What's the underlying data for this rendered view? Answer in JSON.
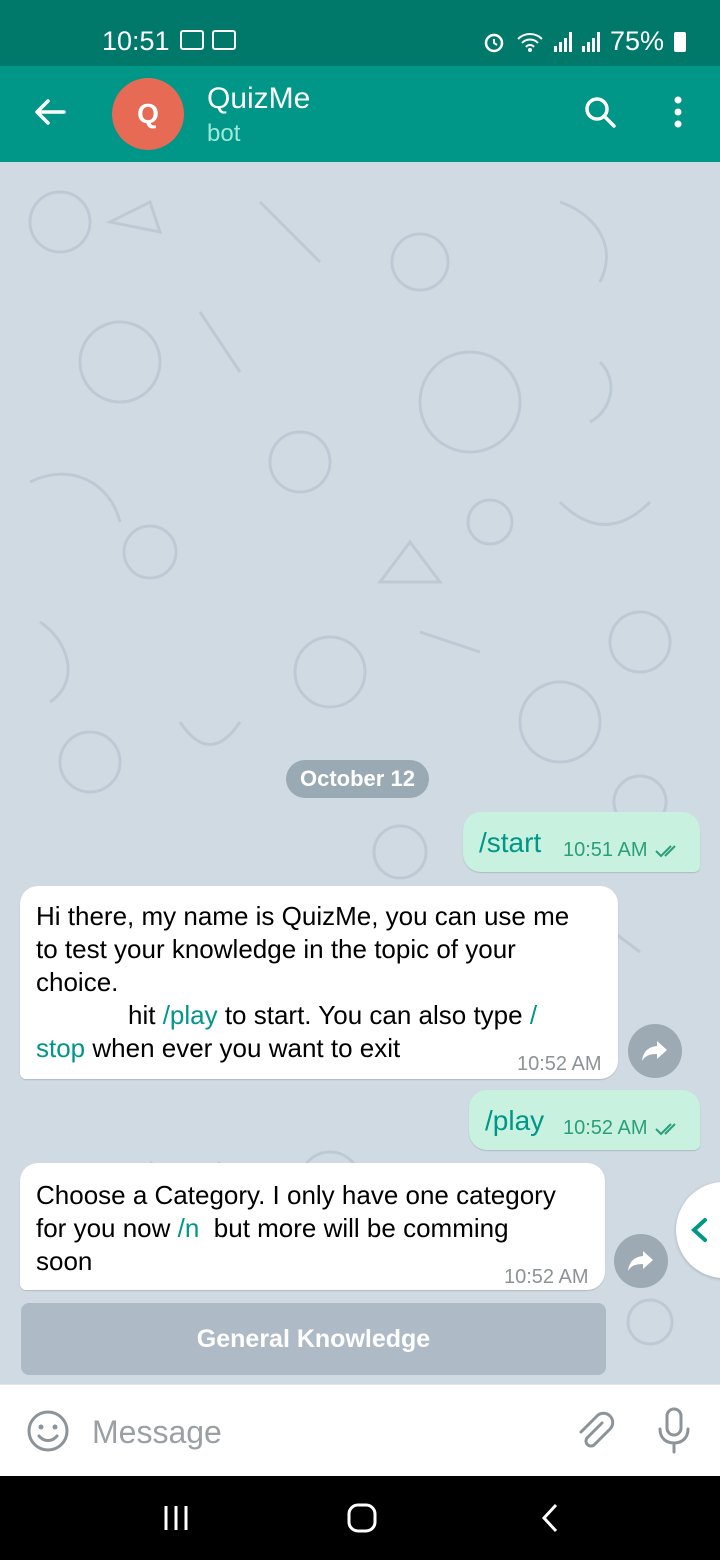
{
  "status_bar": {
    "time": "10:51",
    "battery": "75%"
  },
  "header": {
    "avatar_letter": "Q",
    "title": "QuizMe",
    "subtitle": "bot"
  },
  "chat": {
    "date": "October 12",
    "msg1": {
      "text": "/start",
      "time": "10:51 AM"
    },
    "msg2": {
      "line1": "Hi there, my name is QuizMe, you can use me",
      "line2": "to test your knowledge in the topic of your",
      "line3": "choice.",
      "line4_pre": "hit ",
      "line4_cmd": "/play",
      "line4_post": " to start. You can also type ",
      "line4_cmd2": "/",
      "line5_cmd": "stop",
      "line5_post": " when ever you want to exit",
      "time": "10:52 AM"
    },
    "msg3": {
      "text": "/play",
      "time": "10:52 AM"
    },
    "msg4": {
      "line1": "Choose a Category. I only have one category",
      "line2_pre": "for you now ",
      "line2_cmd": "/n",
      "line2_post": "  but more will be comming",
      "line3": "soon",
      "time": "10:52 AM"
    },
    "keyboard_button": "General Knowledge"
  },
  "input": {
    "placeholder": "Message",
    "value": ""
  },
  "colors": {
    "status_bar": "#00796b",
    "header": "#009688",
    "command": "#009688",
    "outgoing_bubble": "#c9f1df",
    "avatar": "#e76a55"
  }
}
